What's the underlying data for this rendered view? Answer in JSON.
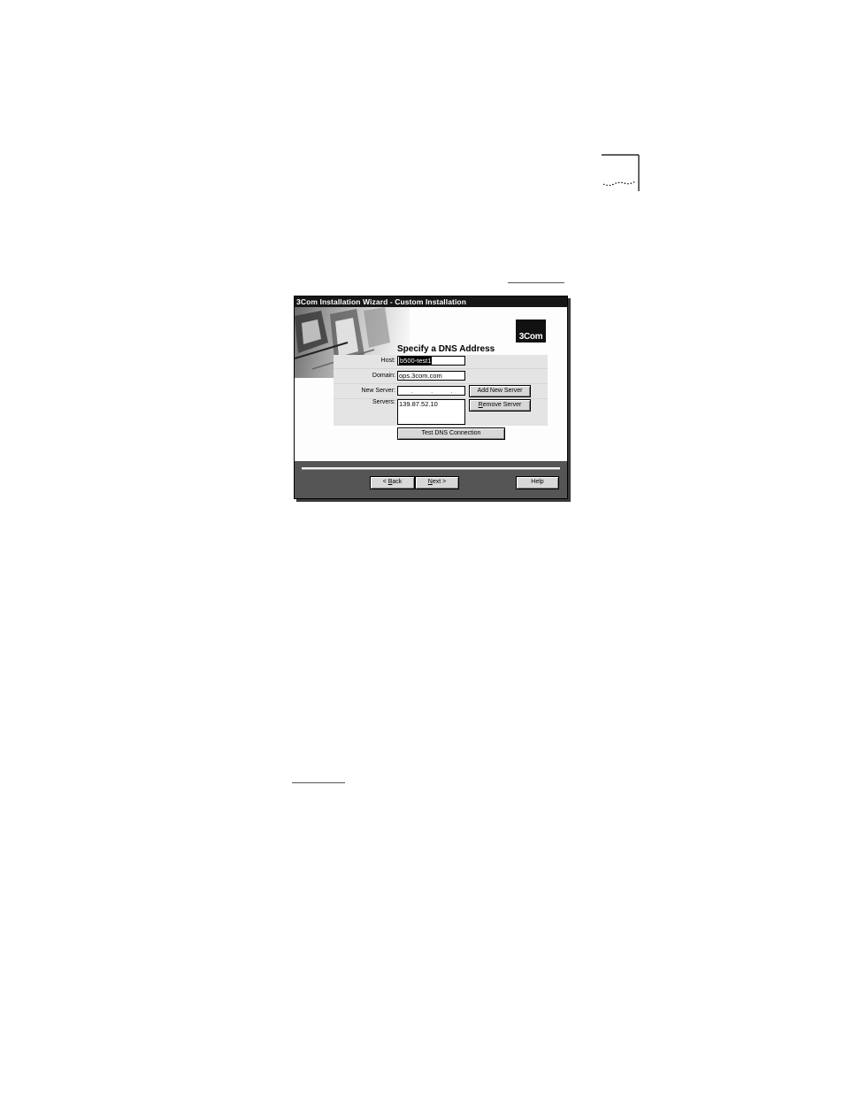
{
  "window": {
    "title": "3Com Installation Wizard - Custom Installation"
  },
  "brand": {
    "logo_text": "3Com"
  },
  "page": {
    "heading": "Specify a DNS Address"
  },
  "form": {
    "host": {
      "label": "Host:",
      "value": "b500-test1"
    },
    "domain": {
      "label": "Domain:",
      "value": "ops.3com.com"
    },
    "new_server": {
      "label": "New Server:",
      "value": ". . ."
    },
    "servers": {
      "label": "Servers:",
      "items": [
        "139.87.52.10"
      ]
    }
  },
  "buttons": {
    "add_new_server": "Add New Server",
    "remove_server_prefix": "R",
    "remove_server_rest": "emove Server",
    "test_dns": "Test DNS Connection",
    "back_prefix": "< ",
    "back_key": "B",
    "back_rest": "ack",
    "next_key": "N",
    "next_rest": "ext >",
    "help": "Help"
  },
  "icons": {
    "corner_mark": "page-corner-mark",
    "banner": "computer-illustration"
  }
}
